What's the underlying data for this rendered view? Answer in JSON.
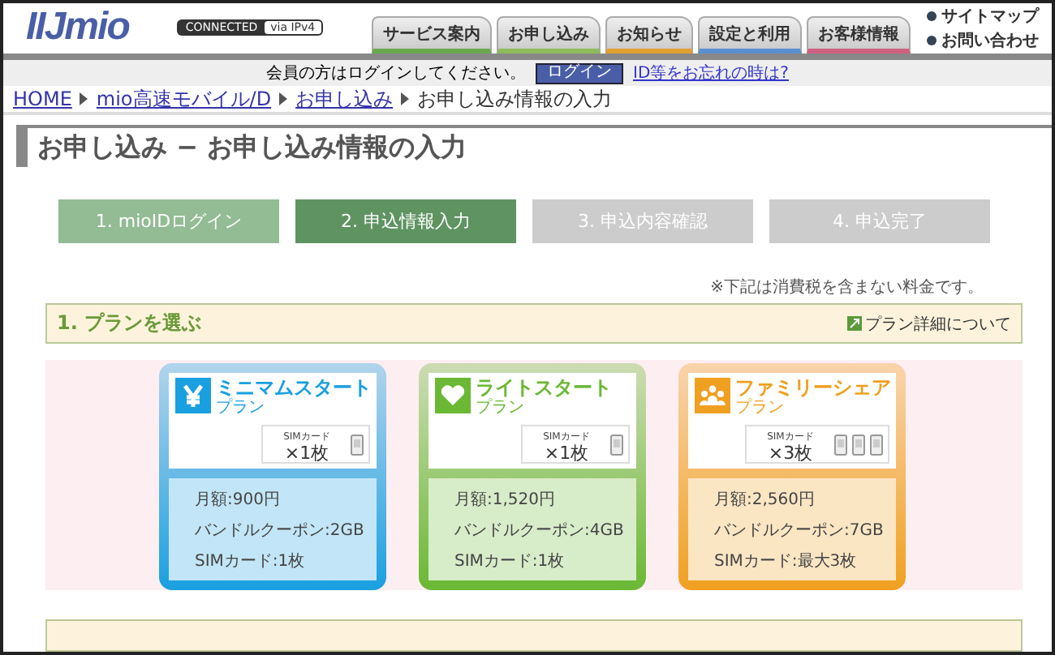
{
  "header": {
    "logo": "IIJmio",
    "badge": {
      "left": "CONNECTED",
      "right": "via IPv4"
    },
    "tabs": [
      {
        "label": "サービス案内",
        "color": "#6aa84f"
      },
      {
        "label": "お申し込み",
        "color": "#8fbc5a"
      },
      {
        "label": "お知らせ",
        "color": "#e0a030"
      },
      {
        "label": "設定と利用",
        "color": "#5b8fd0"
      },
      {
        "label": "お客様情報",
        "color": "#d06080"
      }
    ],
    "links": [
      "サイトマップ",
      "お問い合わせ"
    ]
  },
  "login_bar": {
    "message": "会員の方はログインしてください。",
    "button": "ログイン",
    "link": "ID等をお忘れの時は?"
  },
  "breadcrumb": [
    {
      "label": "HOME",
      "kind": "link"
    },
    {
      "label": "mio高速モバイル/D",
      "kind": "link"
    },
    {
      "label": "お申し込み",
      "kind": "link"
    },
    {
      "label": "お申し込み情報の入力",
      "kind": "current"
    }
  ],
  "page_title": "お申し込み − お申し込み情報の入力",
  "steps": [
    {
      "label": "1. mioIDログイン",
      "kind": "done"
    },
    {
      "label": "2. 申込情報入力",
      "kind": "current"
    },
    {
      "label": "3. 申込内容確認",
      "kind": "todo"
    },
    {
      "label": "4. 申込完了",
      "kind": "todo"
    }
  ],
  "tax_note": "※下記は消費税を含まない料金です。",
  "section": {
    "title": "1. プランを選ぶ",
    "link": "プラン詳細について"
  },
  "plans": [
    {
      "name": "ミニマムスタート",
      "sub": "プラン",
      "kind": "minimum",
      "color": "#1aa0e0",
      "sim_label": "SIMカード",
      "sim_count": "×1枚",
      "details": [
        "月額:900円",
        "バンドルクーポン:2GB",
        "SIMカード:1枚"
      ]
    },
    {
      "name": "ライトスタート",
      "sub": "プラン",
      "kind": "light",
      "color": "#6ab834",
      "sim_label": "SIMカード",
      "sim_count": "×1枚",
      "details": [
        "月額:1,520円",
        "バンドルクーポン:4GB",
        "SIMカード:1枚"
      ]
    },
    {
      "name": "ファミリーシェア",
      "sub": "プラン",
      "kind": "family",
      "color": "#f0a020",
      "sim_label": "SIMカード",
      "sim_count": "×3枚",
      "details": [
        "月額:2,560円",
        "バンドルクーポン:7GB",
        "SIMカード:最大3枚"
      ]
    }
  ]
}
